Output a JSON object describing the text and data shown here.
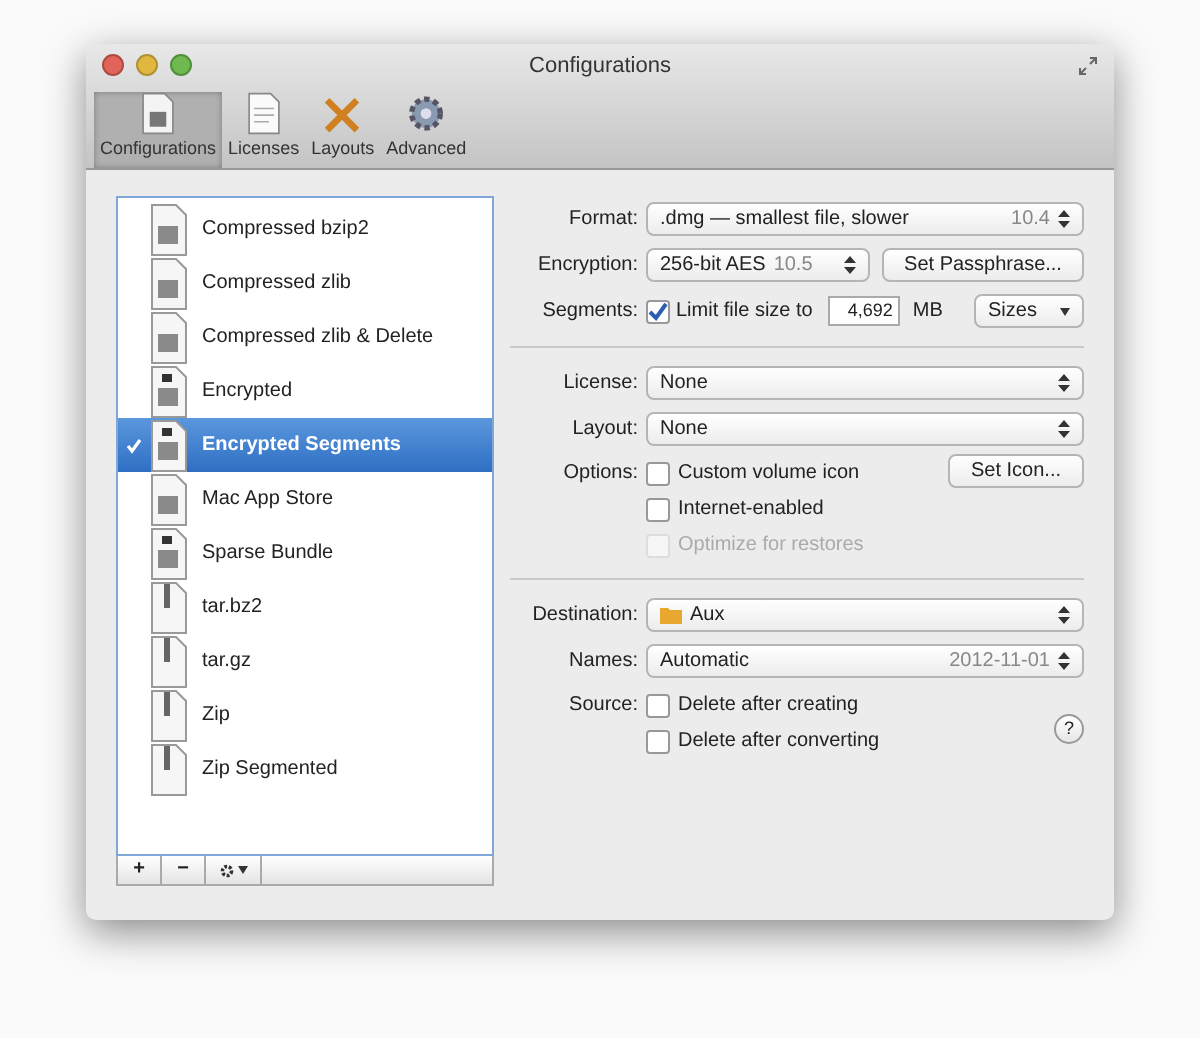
{
  "window": {
    "title": "Configurations"
  },
  "toolbar": [
    {
      "label": "Configurations",
      "kind": "config",
      "selected": true
    },
    {
      "label": "Licenses",
      "kind": "license",
      "selected": false
    },
    {
      "label": "Layouts",
      "kind": "layout",
      "selected": false
    },
    {
      "label": "Advanced",
      "kind": "gear",
      "selected": false
    }
  ],
  "configurations": [
    {
      "name": "Compressed bzip2",
      "kind": "dmg",
      "selected": false
    },
    {
      "name": "Compressed zlib",
      "kind": "dmg",
      "selected": false
    },
    {
      "name": "Compressed zlib & Delete",
      "kind": "dmg",
      "selected": false
    },
    {
      "name": "Encrypted",
      "kind": "locked",
      "selected": false
    },
    {
      "name": "Encrypted Segments",
      "kind": "locked",
      "selected": true
    },
    {
      "name": "Mac App Store",
      "kind": "dmg",
      "selected": false
    },
    {
      "name": "Sparse Bundle",
      "kind": "locked",
      "selected": false
    },
    {
      "name": "tar.bz2",
      "kind": "archive",
      "selected": false
    },
    {
      "name": "tar.gz",
      "kind": "archive",
      "selected": false
    },
    {
      "name": "Zip",
      "kind": "archive",
      "selected": false
    },
    {
      "name": "Zip Segmented",
      "kind": "archive",
      "selected": false
    }
  ],
  "list_buttons": [
    "+",
    "−"
  ],
  "form": {
    "format": {
      "label": "Format:",
      "value": ".dmg — smallest file, slower",
      "version": "10.4"
    },
    "encryption": {
      "label": "Encryption:",
      "value": "256-bit AES",
      "version": "10.5",
      "button": "Set Passphrase..."
    },
    "segments": {
      "label": "Segments:",
      "checkbox": "Limit file size to",
      "checked": true,
      "size": "4,692",
      "unit": "MB",
      "menu": "Sizes"
    },
    "license": {
      "label": "License:",
      "value": "None"
    },
    "layout": {
      "label": "Layout:",
      "value": "None"
    },
    "options": {
      "label": "Options:",
      "button": "Set Icon...",
      "items": [
        {
          "label": "Custom volume icon",
          "checked": false,
          "disabled": false
        },
        {
          "label": "Internet-enabled",
          "checked": false,
          "disabled": false
        },
        {
          "label": "Optimize for restores",
          "checked": false,
          "disabled": true
        }
      ]
    },
    "destination": {
      "label": "Destination:",
      "value": "Aux"
    },
    "names": {
      "label": "Names:",
      "value": "Automatic",
      "date": "2012-11-01"
    },
    "source": {
      "label": "Source:",
      "items": [
        {
          "label": "Delete after creating",
          "checked": false,
          "disabled": false
        },
        {
          "label": "Delete after converting",
          "checked": false,
          "disabled": false
        }
      ]
    },
    "help": "?"
  }
}
